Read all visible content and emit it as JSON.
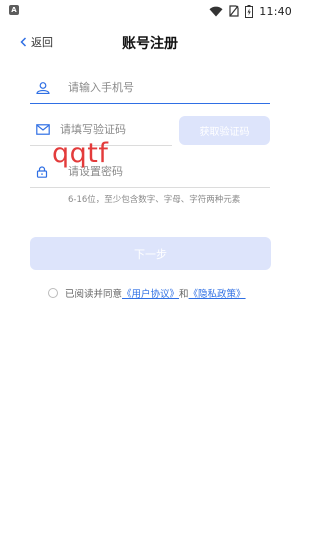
{
  "status_bar": {
    "app_icon_letter": "A",
    "time": "11:40"
  },
  "nav": {
    "back_label": "返回",
    "title": "账号注册"
  },
  "form": {
    "phone_placeholder": "请输入手机号",
    "code_placeholder": "请填写验证码",
    "get_code_label": "获取验证码",
    "password_placeholder": "请设置密码",
    "password_hint": "6-16位，至少包含数字、字母、字符两种元素"
  },
  "watermark": "qqtf",
  "next_label": "下一步",
  "agreement": {
    "prefix": "已阅读并同意",
    "user_agreement": "《用户协议》",
    "joiner": "和",
    "privacy_policy": "《隐私政策》"
  },
  "colors": {
    "accent": "#2f6fe4",
    "disabled_button": "#dde4fb",
    "watermark": "#e33b3b"
  }
}
